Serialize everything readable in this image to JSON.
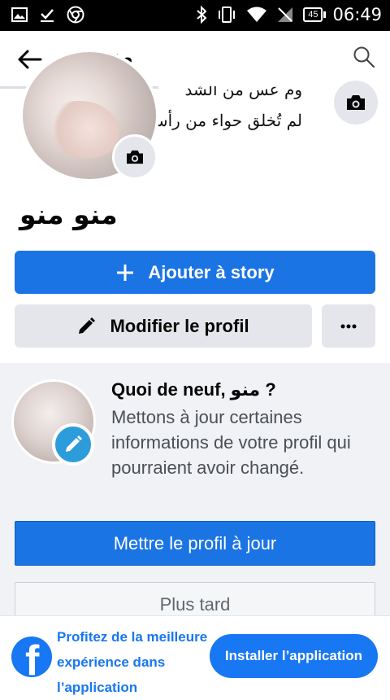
{
  "status_bar": {
    "time": "06:49",
    "battery": "45",
    "icons": [
      "image-icon",
      "download-done-icon",
      "chrome-icon",
      "bluetooth-icon",
      "vibrate-icon",
      "wifi-icon",
      "no-signal-icon",
      "battery-icon"
    ]
  },
  "header": {
    "title": "منو منو",
    "back_icon": "arrow-left-icon",
    "search_icon": "search-icon"
  },
  "profile": {
    "cover_line1": "وم عس من الشد",
    "cover_line2": "لم تُخلق حواء من رأس",
    "name": "منو منو",
    "camera_icon": "camera-icon"
  },
  "actions": {
    "story_label": "Ajouter à story",
    "edit_label": "Modifier le profil",
    "more_icon": "more-dots-icon"
  },
  "update_card": {
    "title": "Quoi de neuf, منو ?",
    "body": "Mettons à jour certaines informations de votre profil qui pourraient avoir changé.",
    "update_button": "Mettre le profil à jour",
    "later_button": "Plus tard"
  },
  "install_banner": {
    "text": "Profitez de la meilleure expérience dans l’application",
    "button": "Installer l’application"
  },
  "colors": {
    "accent": "#1b74e4",
    "brand": "#1877f2",
    "secondary_button": "#e4e6eb",
    "card_bg": "#f0f2f5"
  }
}
